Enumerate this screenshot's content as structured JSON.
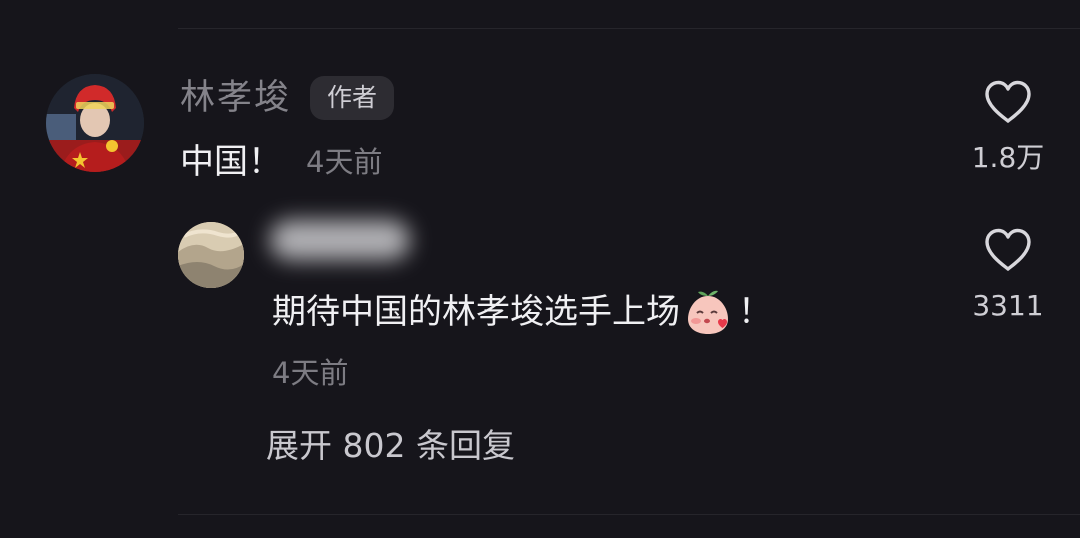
{
  "comment": {
    "author_name": "林孝埈",
    "author_badge": "作者",
    "text": "中国！",
    "time": "4天前",
    "like_count": "1.8万",
    "avatar_icon": "athlete-avatar-icon"
  },
  "reply": {
    "text": "期待中国的林孝埈选手上场",
    "emoji_icon": "peach-blowing-kiss-sticker-icon",
    "text_suffix": "！",
    "time": "4天前",
    "like_count": "3311",
    "avatar_icon": "landscape-avatar-icon"
  },
  "expand_replies_label": "展开 802 条回复",
  "colors": {
    "background": "#16151b",
    "secondary_text": "#7d7c83",
    "primary_text": "#f0f0f3"
  }
}
